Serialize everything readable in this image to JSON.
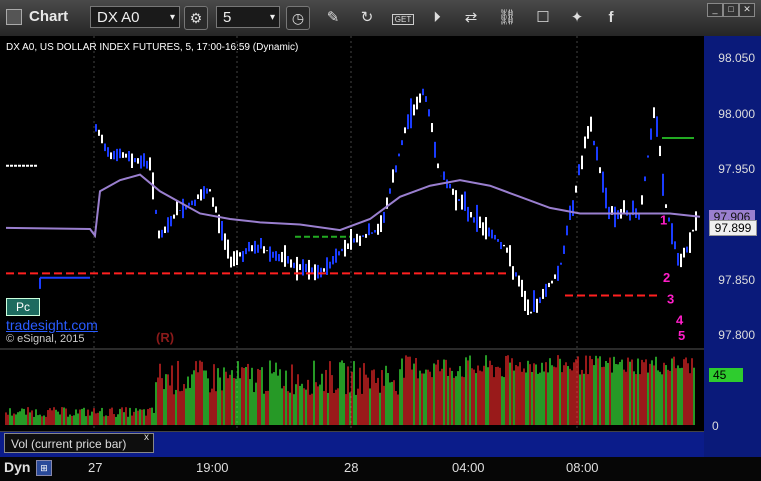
{
  "toolbar": {
    "title": "Chart",
    "symbol": "DX A0",
    "interval": "5",
    "icons": [
      "settings-icon",
      "clock-icon",
      "pencil-icon",
      "refresh-icon",
      "get-icon",
      "play-icon",
      "compare-icon",
      "chat-icon",
      "twitter-icon",
      "facebook-icon"
    ],
    "get_label": "GET"
  },
  "chart": {
    "header": "DX A0, US DOLLAR INDEX FUTURES, 5, 17:00-16:59 (Dynamic)",
    "brand": "tradesight.com",
    "copyright": "© eSignal, 2015",
    "reset_mark": "(R)",
    "pc_label": "Pc",
    "price_labels": [
      "98.050",
      "98.000",
      "97.950",
      "97.906",
      "97.899",
      "97.850",
      "97.800"
    ],
    "current_price": "97.899",
    "ma_price": "97.906",
    "time_labels": [
      "27",
      "19:00",
      "28",
      "04:00",
      "08:00"
    ],
    "counts_magenta": [
      "1",
      "2",
      "3",
      "4",
      "5"
    ],
    "colors": {
      "price_up": "#ffffff",
      "price_down": "#1a3cff",
      "ma_line": "#9a7fcf",
      "dashed_red": "#ff2020",
      "dashed_green": "#22aa22",
      "count_green": "#2eaa2e",
      "count_magenta": "#ff1ec8",
      "vol_green": "#33cc33",
      "vol_red": "#cc2222"
    }
  },
  "volume": {
    "label": "Vol (current price bar)",
    "value_tag": "45",
    "zero_label": "0",
    "close_label": "x"
  },
  "footer": {
    "mode_label": "Dyn"
  }
}
